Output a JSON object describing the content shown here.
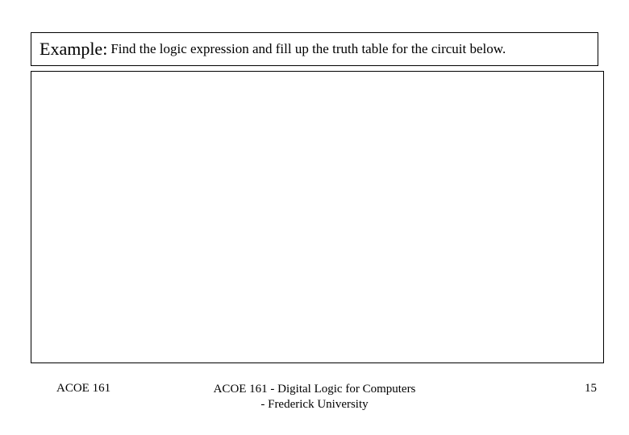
{
  "title": {
    "prefix": "Example:",
    "rest": "Find the logic expression and fill up the truth table for the circuit below."
  },
  "footer": {
    "left": "ACOE 161",
    "center_line1": "ACOE 161 - Digital Logic for Computers",
    "center_line2": "- Frederick University",
    "right": "15"
  }
}
